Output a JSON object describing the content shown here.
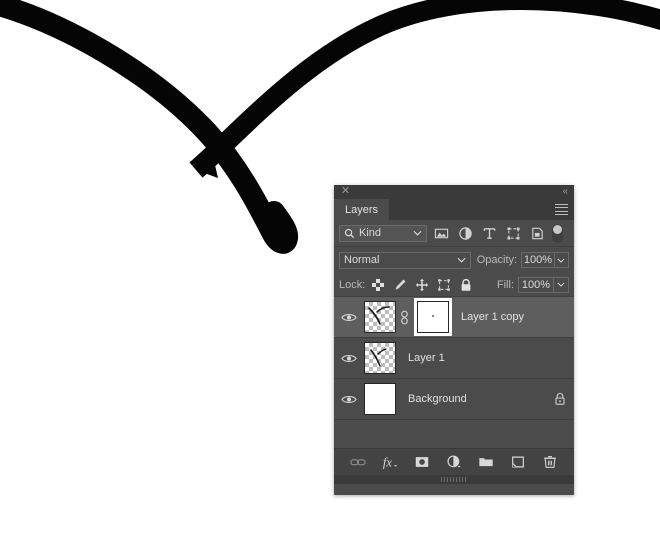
{
  "panel": {
    "title": "Layers",
    "close_icon": "close-icon",
    "collapse_icon": "collapse-chevrons-icon",
    "menu_icon": "panel-menu-icon"
  },
  "filter": {
    "kind_label": "Kind",
    "search_icon": "search-icon",
    "chevron_icon": "chevron-down-icon",
    "icons": [
      "pixel-layer-filter-icon",
      "adjustment-layer-filter-icon",
      "type-layer-filter-icon",
      "shape-layer-filter-icon",
      "smart-object-filter-icon"
    ],
    "toggle_icon": "filter-enable-toggle"
  },
  "blend": {
    "mode": "Normal",
    "opacity_label": "Opacity:",
    "opacity_value": "100%",
    "fill_label": "Fill:",
    "fill_value": "100%"
  },
  "lock": {
    "label": "Lock:",
    "icons": [
      "lock-transparent-pixels-icon",
      "lock-image-pixels-icon",
      "lock-position-icon",
      "lock-artboard-nesting-icon",
      "lock-all-icon"
    ]
  },
  "layers": [
    {
      "name": "Layer 1 copy",
      "visible": true,
      "selected": true,
      "thumb": "transparent-artwork",
      "has_link": true,
      "has_mask": true,
      "locked": false
    },
    {
      "name": "Layer 1",
      "visible": true,
      "selected": false,
      "thumb": "transparent-artwork",
      "has_link": false,
      "has_mask": false,
      "locked": false
    },
    {
      "name": "Background",
      "visible": true,
      "selected": false,
      "thumb": "solid-white",
      "has_link": false,
      "has_mask": false,
      "locked": true
    }
  ],
  "bottom_toolbar": [
    "link-layers-icon",
    "layer-style-fx-icon",
    "add-layer-mask-icon",
    "new-adjustment-layer-icon",
    "new-group-icon",
    "new-layer-icon",
    "delete-layer-icon"
  ],
  "colors": {
    "panel_bg": "#4b4b4b",
    "panel_chrome": "#3a3a3a",
    "row_selected": "#5e5e5e",
    "text": "#d6d6d6",
    "artwork_stroke": "#050505",
    "canvas_bg": "#ffffff"
  },
  "canvas": {
    "description": "two crossing black brush strokes"
  }
}
